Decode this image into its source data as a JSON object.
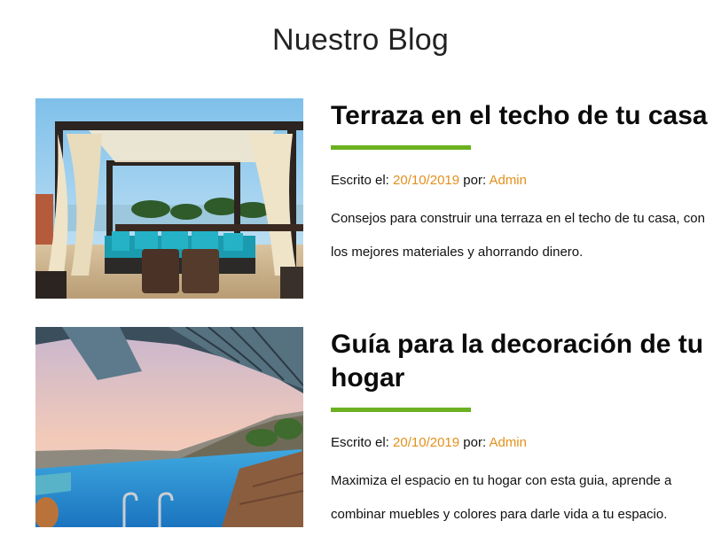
{
  "page": {
    "title": "Nuestro Blog"
  },
  "posts": [
    {
      "title": "Terraza en el techo de tu casa",
      "meta_prefix": "Escrito el: ",
      "date": "20/10/2019",
      "by_label": " por: ",
      "author": "Admin",
      "excerpt": "Consejos para construir una terraza en el techo de tu casa, con los mejores materiales y ahorrando dinero.",
      "image": "rooftop-terrace-photo"
    },
    {
      "title": "Guía para la decoración de tu hogar",
      "meta_prefix": "Escrito el: ",
      "date": "20/10/2019",
      "by_label": " por: ",
      "author": "Admin",
      "excerpt": "Maximiza el espacio en tu hogar con esta guia, aprende a combinar muebles y colores para darle vida a tu espacio.",
      "image": "infinity-pool-photo"
    }
  ],
  "colors": {
    "accent_rule": "#6bb120",
    "link": "#e2901c"
  }
}
